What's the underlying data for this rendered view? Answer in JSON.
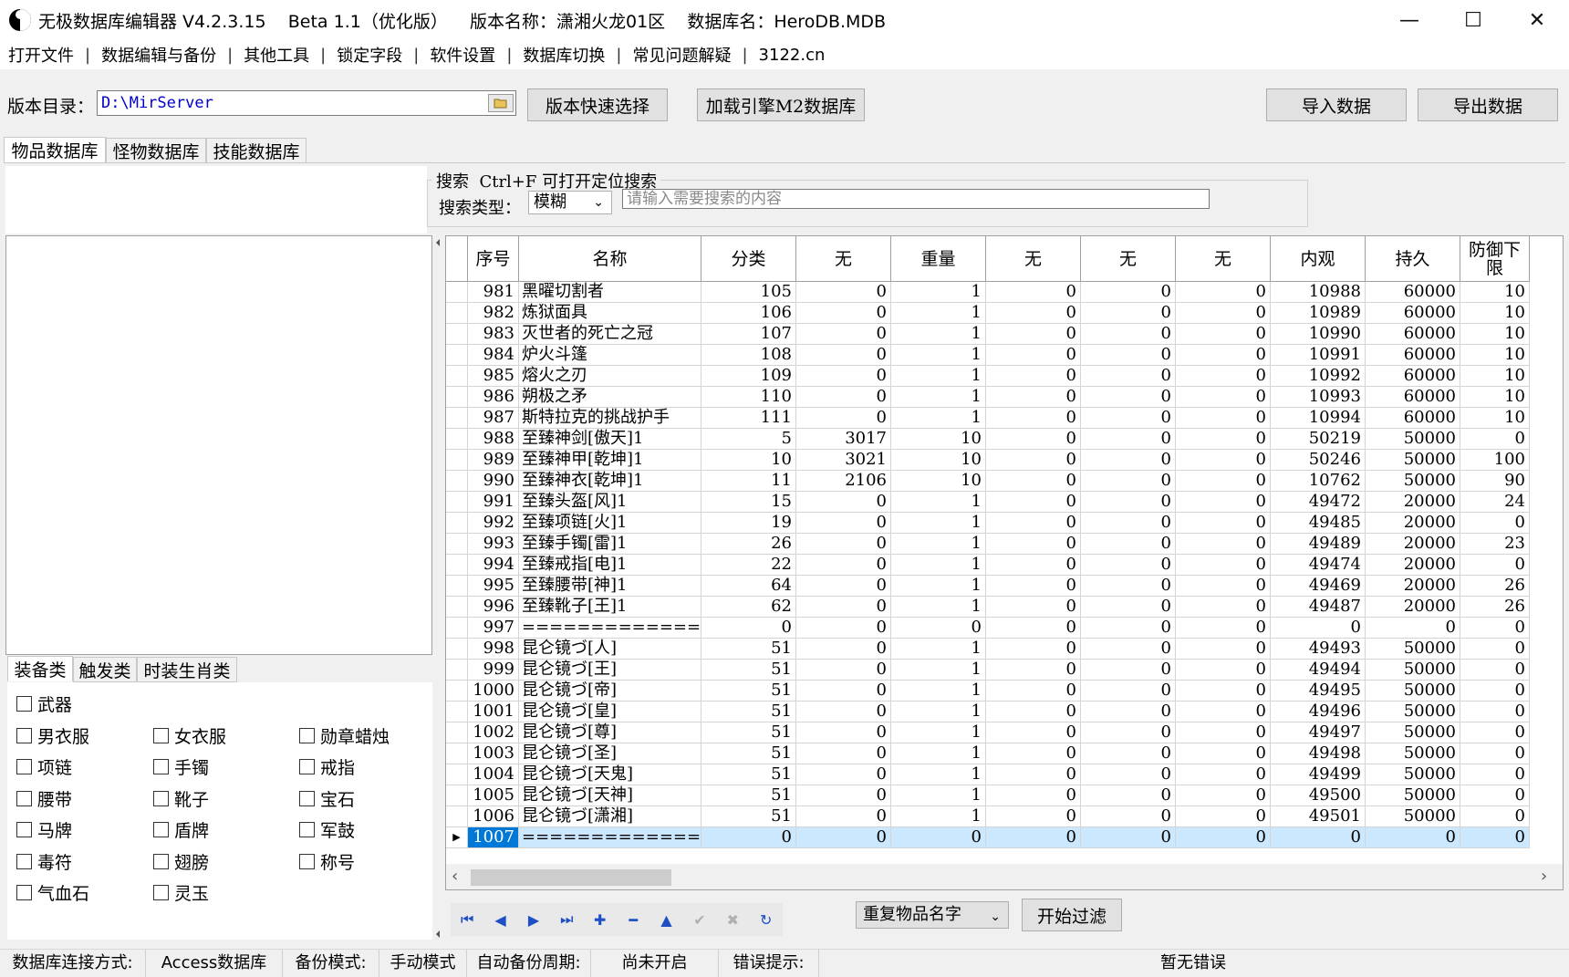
{
  "window": {
    "title": "无极数据库编辑器 V4.2.3.15    Beta 1.1（优化版）    版本名称：潇湘火龙01区    数据库名：HeroDB.MDB",
    "minimize_glyph": "—",
    "maximize_glyph": "☐",
    "close_glyph": "✕"
  },
  "menu": {
    "items": [
      "打开文件",
      "数据编辑与备份",
      "其他工具",
      "锁定字段",
      "软件设置",
      "数据库切换",
      "常见问题解疑",
      "3122.cn"
    ],
    "separator": "|"
  },
  "toolbar": {
    "dir_label": "版本目录：",
    "dir_value": "D:\\MirServer",
    "quick_select": "版本快速选择",
    "load_m2": "加载引擎M2数据库",
    "import": "导入数据",
    "export": "导出数据"
  },
  "tabs": [
    "物品数据库",
    "怪物数据库",
    "技能数据库"
  ],
  "search": {
    "legend": "搜索  Ctrl+F 可打开定位搜索",
    "type_label": "搜索类型：",
    "type_value": "模糊",
    "placeholder": "请输入需要搜索的内容"
  },
  "category_tabs": [
    "装备类",
    "触发类",
    "时装生肖类"
  ],
  "checkboxes": {
    "weapon": "武器",
    "grid": [
      [
        "男衣服",
        "女衣服",
        "勋章蜡烛"
      ],
      [
        "项链",
        "手镯",
        "戒指"
      ],
      [
        "腰带",
        "靴子",
        "宝石"
      ],
      [
        "马牌",
        "盾牌",
        "军鼓"
      ],
      [
        "毒符",
        "翅膀",
        "称号"
      ],
      [
        "气血石",
        "灵玉",
        ""
      ]
    ]
  },
  "grid": {
    "headers": [
      "序号",
      "名称",
      "分类",
      "无",
      "重量",
      "无",
      "无",
      "无",
      "内观",
      "持久",
      "防御下限"
    ],
    "rows": [
      [
        "981",
        "黑曜切割者",
        "105",
        "0",
        "1",
        "0",
        "0",
        "0",
        "10988",
        "60000",
        "10"
      ],
      [
        "982",
        "炼狱面具",
        "106",
        "0",
        "1",
        "0",
        "0",
        "0",
        "10989",
        "60000",
        "10"
      ],
      [
        "983",
        "灭世者的死亡之冠",
        "107",
        "0",
        "1",
        "0",
        "0",
        "0",
        "10990",
        "60000",
        "10"
      ],
      [
        "984",
        "炉火斗篷",
        "108",
        "0",
        "1",
        "0",
        "0",
        "0",
        "10991",
        "60000",
        "10"
      ],
      [
        "985",
        "熔火之刃",
        "109",
        "0",
        "1",
        "0",
        "0",
        "0",
        "10992",
        "60000",
        "10"
      ],
      [
        "986",
        "朔极之矛",
        "110",
        "0",
        "1",
        "0",
        "0",
        "0",
        "10993",
        "60000",
        "10"
      ],
      [
        "987",
        "斯特拉克的挑战护手",
        "111",
        "0",
        "1",
        "0",
        "0",
        "0",
        "10994",
        "60000",
        "10"
      ],
      [
        "988",
        "至臻神剑[傲天]1",
        "5",
        "3017",
        "10",
        "0",
        "0",
        "0",
        "50219",
        "50000",
        "0"
      ],
      [
        "989",
        "至臻神甲[乾坤]1",
        "10",
        "3021",
        "10",
        "0",
        "0",
        "0",
        "50246",
        "50000",
        "100"
      ],
      [
        "990",
        "至臻神衣[乾坤]1",
        "11",
        "2106",
        "10",
        "0",
        "0",
        "0",
        "10762",
        "50000",
        "90"
      ],
      [
        "991",
        "至臻头盔[风]1",
        "15",
        "0",
        "1",
        "0",
        "0",
        "0",
        "49472",
        "20000",
        "24"
      ],
      [
        "992",
        "至臻项链[火]1",
        "19",
        "0",
        "1",
        "0",
        "0",
        "0",
        "49485",
        "20000",
        "0"
      ],
      [
        "993",
        "至臻手镯[雷]1",
        "26",
        "0",
        "1",
        "0",
        "0",
        "0",
        "49489",
        "20000",
        "23"
      ],
      [
        "994",
        "至臻戒指[电]1",
        "22",
        "0",
        "1",
        "0",
        "0",
        "0",
        "49474",
        "20000",
        "0"
      ],
      [
        "995",
        "至臻腰带[神]1",
        "64",
        "0",
        "1",
        "0",
        "0",
        "0",
        "49469",
        "20000",
        "26"
      ],
      [
        "996",
        "至臻靴子[王]1",
        "62",
        "0",
        "1",
        "0",
        "0",
        "0",
        "49487",
        "20000",
        "26"
      ],
      [
        "997",
        "====================",
        "0",
        "0",
        "0",
        "0",
        "0",
        "0",
        "0",
        "0",
        "0"
      ],
      [
        "998",
        "昆仑镜づ[人]",
        "51",
        "0",
        "1",
        "0",
        "0",
        "0",
        "49493",
        "50000",
        "0"
      ],
      [
        "999",
        "昆仑镜づ[王]",
        "51",
        "0",
        "1",
        "0",
        "0",
        "0",
        "49494",
        "50000",
        "0"
      ],
      [
        "1000",
        "昆仑镜づ[帝]",
        "51",
        "0",
        "1",
        "0",
        "0",
        "0",
        "49495",
        "50000",
        "0"
      ],
      [
        "1001",
        "昆仑镜づ[皇]",
        "51",
        "0",
        "1",
        "0",
        "0",
        "0",
        "49496",
        "50000",
        "0"
      ],
      [
        "1002",
        "昆仑镜づ[尊]",
        "51",
        "0",
        "1",
        "0",
        "0",
        "0",
        "49497",
        "50000",
        "0"
      ],
      [
        "1003",
        "昆仑镜づ[圣]",
        "51",
        "0",
        "1",
        "0",
        "0",
        "0",
        "49498",
        "50000",
        "0"
      ],
      [
        "1004",
        "昆仑镜づ[天鬼]",
        "51",
        "0",
        "1",
        "0",
        "0",
        "0",
        "49499",
        "50000",
        "0"
      ],
      [
        "1005",
        "昆仑镜づ[天神]",
        "51",
        "0",
        "1",
        "0",
        "0",
        "0",
        "49500",
        "50000",
        "0"
      ],
      [
        "1006",
        "昆仑镜づ[潇湘]",
        "51",
        "0",
        "1",
        "0",
        "0",
        "0",
        "49501",
        "50000",
        "0"
      ],
      [
        "1007",
        "====================",
        "0",
        "0",
        "0",
        "0",
        "0",
        "0",
        "0",
        "0",
        "0"
      ]
    ],
    "selected_row": "1007"
  },
  "nav": {
    "first": "⏮",
    "prev": "◀",
    "next": "▶",
    "last": "⏭",
    "add": "✚",
    "delete": "━",
    "up": "▲",
    "post": "✔",
    "cancel": "✖",
    "refresh": "↻"
  },
  "filter": {
    "select_value": "重复物品名字",
    "button": "开始过滤"
  },
  "status": {
    "conn_label": "数据库连接方式:",
    "conn_value": "Access数据库",
    "backup_label": "备份模式:",
    "backup_value": "手动模式",
    "auto_label": "自动备份周期:",
    "auto_value": "尚未开启",
    "error_label": "错误提示:",
    "error_value": "暂无错误"
  },
  "colors": {
    "accent": "#0078d7",
    "selected_row": "#cce8ff",
    "path_text": "#0000c8"
  }
}
